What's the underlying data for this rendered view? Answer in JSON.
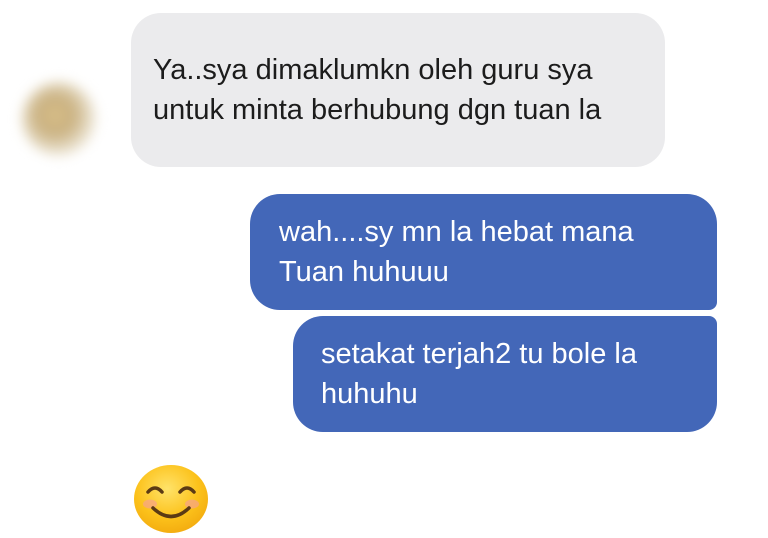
{
  "conversation": {
    "incoming_message": "Ya..sya dimaklumkn oleh guru sya untuk minta berhubung dgn tuan la",
    "outgoing_messages": [
      "wah....sy mn la hebat mana Tuan huhuuu",
      "setakat terjah2 tu bole la huhuhu"
    ],
    "reaction_emoji": "smiling-face-with-smiling-eyes"
  },
  "colors": {
    "incoming_bubble": "#ebebed",
    "outgoing_bubble": "#4367b8",
    "outgoing_text": "#ffffff"
  }
}
